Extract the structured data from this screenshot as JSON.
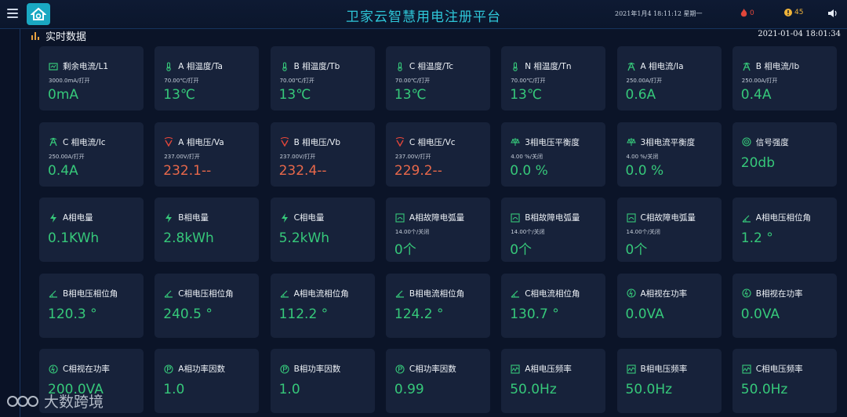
{
  "header": {
    "title": "卫家云智慧用电注册平台",
    "datetime": "2021年1月4 18:11:12 星期一",
    "fire_count": "0",
    "warning_count": "45"
  },
  "section": {
    "title": "实时数据",
    "timestamp": "2021-01-04 18:01:34"
  },
  "cards": [
    {
      "icon": "leakage-icon",
      "label": "剩余电流/L1",
      "sub": "3000.0mA/打开",
      "value": "0mA",
      "value_color": "green"
    },
    {
      "icon": "thermometer-icon",
      "label": "A 相温度/Ta",
      "sub": "70.00℃/打开",
      "value": "13℃",
      "value_color": "green"
    },
    {
      "icon": "thermometer-icon",
      "label": "B 相温度/Tb",
      "sub": "70.00℃/打开",
      "value": "13℃",
      "value_color": "green"
    },
    {
      "icon": "thermometer-icon",
      "label": "C 相温度/Tc",
      "sub": "70.00℃/打开",
      "value": "13℃",
      "value_color": "green"
    },
    {
      "icon": "thermometer-icon",
      "label": "N 相温度/Tn",
      "sub": "70.00℃/打开",
      "value": "13℃",
      "value_color": "green"
    },
    {
      "icon": "ammeter-icon",
      "label": "A 相电流/Ia",
      "sub": "250.00A/打开",
      "value": "0.6A",
      "value_color": "green"
    },
    {
      "icon": "ammeter-icon",
      "label": "B 相电流/Ib",
      "sub": "250.00A/打开",
      "value": "0.4A",
      "value_color": "green"
    },
    {
      "icon": "ammeter-icon",
      "label": "C 相电流/Ic",
      "sub": "250.00A/打开",
      "value": "0.4A",
      "value_color": "green"
    },
    {
      "icon": "voltmeter-icon",
      "label": "A 相电压/Va",
      "sub": "237.00V/打开",
      "value": "232.1--",
      "value_color": "red"
    },
    {
      "icon": "voltmeter-icon",
      "label": "B 相电压/Vb",
      "sub": "237.00V/打开",
      "value": "232.4--",
      "value_color": "red"
    },
    {
      "icon": "voltmeter-icon",
      "label": "C 相电压/Vc",
      "sub": "237.00V/打开",
      "value": "229.2--",
      "value_color": "red"
    },
    {
      "icon": "balance-icon",
      "label": "3相电压平衡度",
      "sub": "4.00 %/关闭",
      "value": "0.0 %",
      "value_color": "green"
    },
    {
      "icon": "balance-icon",
      "label": "3相电流平衡度",
      "sub": "4.00 %/关闭",
      "value": "0.0 %",
      "value_color": "green"
    },
    {
      "icon": "signal-icon",
      "label": "信号强度",
      "sub": "",
      "value": "20db",
      "value_color": "green"
    },
    {
      "icon": "lightning-icon",
      "label": "A相电量",
      "sub": "",
      "value": "0.1KWh",
      "value_color": "green"
    },
    {
      "icon": "lightning-icon",
      "label": "B相电量",
      "sub": "",
      "value": "2.8kWh",
      "value_color": "green"
    },
    {
      "icon": "lightning-icon",
      "label": "C相电量",
      "sub": "",
      "value": "5.2kWh",
      "value_color": "green"
    },
    {
      "icon": "arc-fault-icon",
      "label": "A相故障电弧量",
      "sub": "14.00个/关闭",
      "value": "0个",
      "value_color": "green"
    },
    {
      "icon": "arc-fault-icon",
      "label": "B相故障电弧量",
      "sub": "14.00个/关闭",
      "value": "0个",
      "value_color": "green"
    },
    {
      "icon": "arc-fault-icon",
      "label": "C相故障电弧量",
      "sub": "14.00个/关闭",
      "value": "0个",
      "value_color": "green"
    },
    {
      "icon": "angle-icon",
      "label": "A相电压相位角",
      "sub": "",
      "value": "1.2 °",
      "value_color": "green"
    },
    {
      "icon": "angle-icon",
      "label": "B相电压相位角",
      "sub": "",
      "value": "120.3 °",
      "value_color": "green"
    },
    {
      "icon": "angle-icon",
      "label": "C相电压相位角",
      "sub": "",
      "value": "240.5 °",
      "value_color": "green"
    },
    {
      "icon": "angle-icon",
      "label": "A相电流相位角",
      "sub": "",
      "value": "112.2 °",
      "value_color": "green"
    },
    {
      "icon": "angle-icon",
      "label": "B相电流相位角",
      "sub": "",
      "value": "124.2 °",
      "value_color": "green"
    },
    {
      "icon": "angle-icon",
      "label": "C相电流相位角",
      "sub": "",
      "value": "130.7 °",
      "value_color": "green"
    },
    {
      "icon": "power-icon",
      "label": "A相视在功率",
      "sub": "",
      "value": "0.0VA",
      "value_color": "green"
    },
    {
      "icon": "power-icon",
      "label": "B相视在功率",
      "sub": "",
      "value": "0.0VA",
      "value_color": "green"
    },
    {
      "icon": "power-icon",
      "label": "C相视在功率",
      "sub": "",
      "value": "200.0VA",
      "value_color": "green"
    },
    {
      "icon": "power-factor-icon",
      "label": "A相功率因数",
      "sub": "",
      "value": "1.0",
      "value_color": "green"
    },
    {
      "icon": "power-factor-icon",
      "label": "B相功率因数",
      "sub": "",
      "value": "1.0",
      "value_color": "green"
    },
    {
      "icon": "power-factor-icon",
      "label": "C相功率因数",
      "sub": "",
      "value": "0.99",
      "value_color": "green"
    },
    {
      "icon": "frequency-icon",
      "label": "A相电压频率",
      "sub": "",
      "value": "50.0Hz",
      "value_color": "green"
    },
    {
      "icon": "frequency-icon",
      "label": "B相电压频率",
      "sub": "",
      "value": "50.0Hz",
      "value_color": "green"
    },
    {
      "icon": "frequency-icon",
      "label": "C相电压频率",
      "sub": "",
      "value": "50.0Hz",
      "value_color": "green"
    }
  ],
  "watermark": "大数跨境",
  "colors": {
    "accent": "#2ec6d8",
    "value_green": "#36c87a",
    "value_red": "#e8684a",
    "card_bg": "#17223a"
  }
}
